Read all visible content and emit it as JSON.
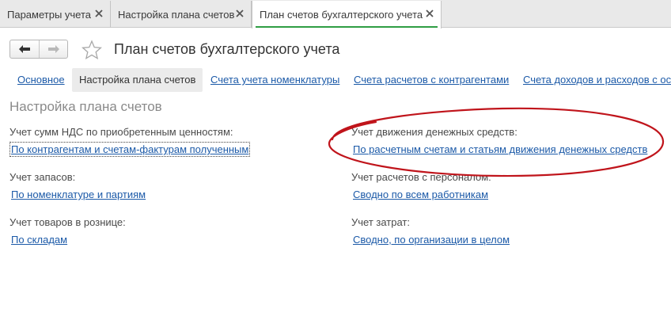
{
  "tabs": [
    {
      "label": "Параметры учета"
    },
    {
      "label": "Настройка плана счетов"
    },
    {
      "label": "План счетов бухгалтерского учета"
    }
  ],
  "header": {
    "title": "План счетов бухгалтерского учета"
  },
  "sections": [
    {
      "label": "Основное"
    },
    {
      "label": "Настройка плана счетов"
    },
    {
      "label": "Счета учета номенклатуры"
    },
    {
      "label": "Счета расчетов с контрагентами"
    },
    {
      "label": "Счета доходов и расходов с ос"
    }
  ],
  "main": {
    "title": "Настройка плана счетов",
    "fields": [
      {
        "label": "Учет сумм НДС по приобретенным ценностям:",
        "value": "По контрагентам и счетам-фактурам полученным"
      },
      {
        "label": "Учет движения денежных средств:",
        "value": "По расчетным счетам и статьям движения денежных средств"
      },
      {
        "label": "Учет запасов:",
        "value": "По номенклатуре и партиям"
      },
      {
        "label": "Учет расчетов с персоналом:",
        "value": "Сводно по всем работникам"
      },
      {
        "label": "Учет товаров в рознице:",
        "value": "По складам"
      },
      {
        "label": "Учет затрат:",
        "value": "Сводно, по организации в целом"
      }
    ]
  },
  "colors": {
    "link": "#1c5aa8",
    "active_tab_underline": "#2f9e44",
    "annotation_ellipse": "#c0141b"
  }
}
